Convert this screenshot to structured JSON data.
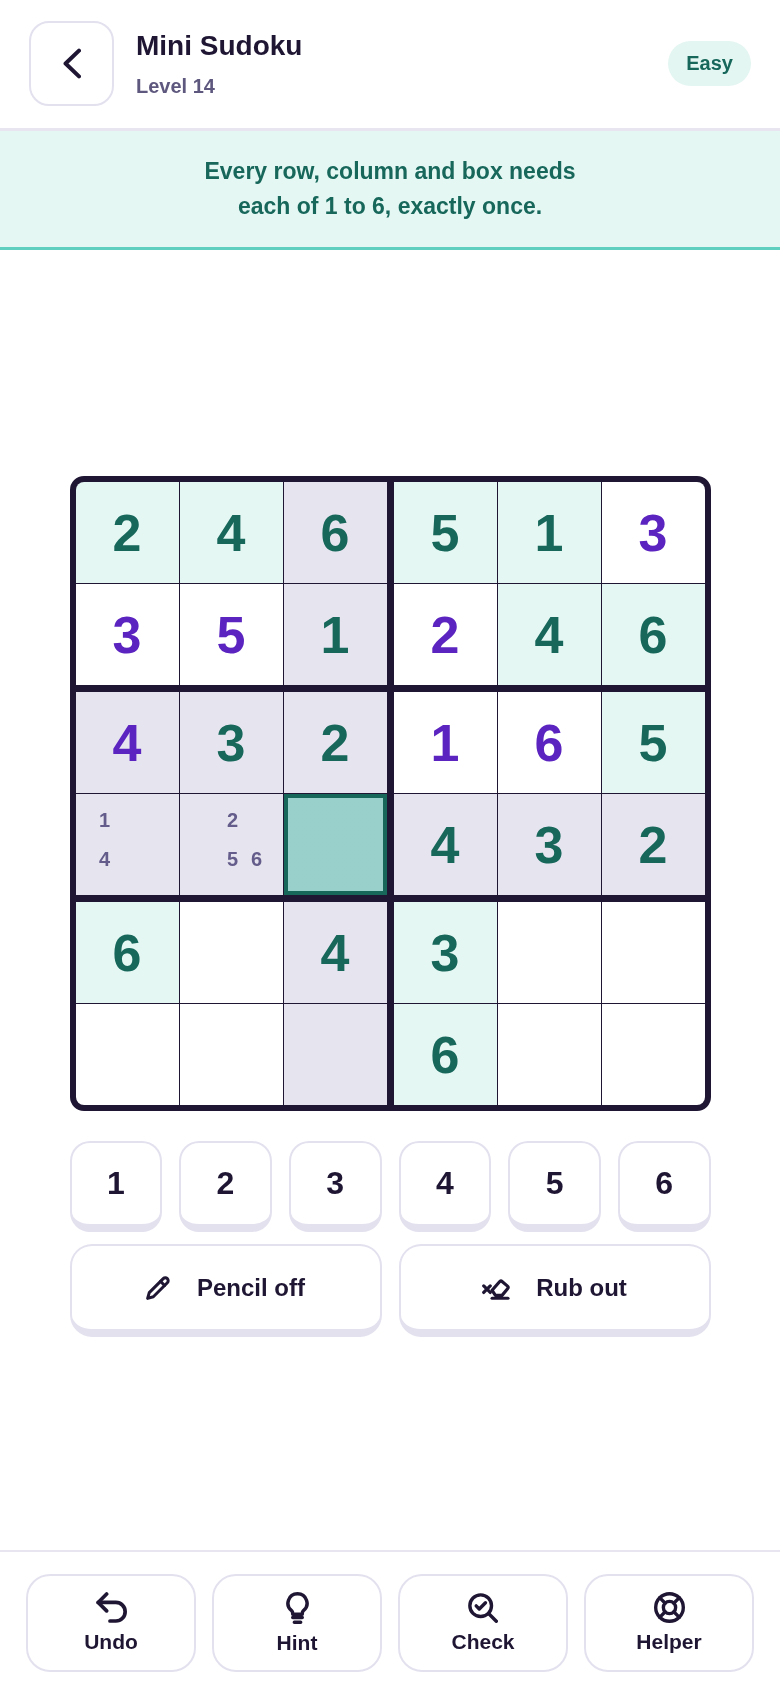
{
  "header": {
    "title": "Mini Sudoku",
    "subtitle": "Level 14",
    "difficulty": "Easy"
  },
  "instructions": "Every row, column and box needs each of 1 to 6, exactly once.",
  "grid": {
    "rows": [
      [
        {
          "kind": "digit",
          "value": "2",
          "given": true,
          "highlighted": false,
          "selected": false
        },
        {
          "kind": "digit",
          "value": "4",
          "given": true,
          "highlighted": false,
          "selected": false
        },
        {
          "kind": "digit",
          "value": "6",
          "given": true,
          "highlighted": true,
          "selected": false
        },
        {
          "kind": "digit",
          "value": "5",
          "given": true,
          "highlighted": false,
          "selected": false
        },
        {
          "kind": "digit",
          "value": "1",
          "given": true,
          "highlighted": false,
          "selected": false
        },
        {
          "kind": "digit",
          "value": "3",
          "given": false,
          "highlighted": false,
          "selected": false
        }
      ],
      [
        {
          "kind": "digit",
          "value": "3",
          "given": false,
          "highlighted": false,
          "selected": false
        },
        {
          "kind": "digit",
          "value": "5",
          "given": false,
          "highlighted": false,
          "selected": false
        },
        {
          "kind": "digit",
          "value": "1",
          "given": true,
          "highlighted": true,
          "selected": false
        },
        {
          "kind": "digit",
          "value": "2",
          "given": false,
          "highlighted": false,
          "selected": false
        },
        {
          "kind": "digit",
          "value": "4",
          "given": true,
          "highlighted": false,
          "selected": false
        },
        {
          "kind": "digit",
          "value": "6",
          "given": true,
          "highlighted": false,
          "selected": false
        }
      ],
      [
        {
          "kind": "digit",
          "value": "4",
          "given": false,
          "highlighted": true,
          "selected": false
        },
        {
          "kind": "digit",
          "value": "3",
          "given": true,
          "highlighted": true,
          "selected": false
        },
        {
          "kind": "digit",
          "value": "2",
          "given": true,
          "highlighted": true,
          "selected": false
        },
        {
          "kind": "digit",
          "value": "1",
          "given": false,
          "highlighted": false,
          "selected": false
        },
        {
          "kind": "digit",
          "value": "6",
          "given": false,
          "highlighted": false,
          "selected": false
        },
        {
          "kind": "digit",
          "value": "5",
          "given": true,
          "highlighted": false,
          "selected": false
        }
      ],
      [
        {
          "kind": "notes",
          "notes": [
            "1",
            "4"
          ],
          "given": false,
          "highlighted": true,
          "selected": false
        },
        {
          "kind": "notes",
          "notes": [
            "2",
            "5",
            "6"
          ],
          "given": false,
          "highlighted": true,
          "selected": false
        },
        {
          "kind": "empty",
          "given": false,
          "highlighted": true,
          "selected": true
        },
        {
          "kind": "digit",
          "value": "4",
          "given": true,
          "highlighted": true,
          "selected": false
        },
        {
          "kind": "digit",
          "value": "3",
          "given": true,
          "highlighted": true,
          "selected": false
        },
        {
          "kind": "digit",
          "value": "2",
          "given": true,
          "highlighted": true,
          "selected": false
        }
      ],
      [
        {
          "kind": "digit",
          "value": "6",
          "given": true,
          "highlighted": false,
          "selected": false
        },
        {
          "kind": "empty",
          "given": false,
          "highlighted": false,
          "selected": false
        },
        {
          "kind": "digit",
          "value": "4",
          "given": true,
          "highlighted": true,
          "selected": false
        },
        {
          "kind": "digit",
          "value": "3",
          "given": true,
          "highlighted": false,
          "selected": false
        },
        {
          "kind": "empty",
          "given": false,
          "highlighted": false,
          "selected": false
        },
        {
          "kind": "empty",
          "given": false,
          "highlighted": false,
          "selected": false
        }
      ],
      [
        {
          "kind": "empty",
          "given": false,
          "highlighted": false,
          "selected": false
        },
        {
          "kind": "empty",
          "given": false,
          "highlighted": false,
          "selected": false
        },
        {
          "kind": "empty",
          "given": false,
          "highlighted": true,
          "selected": false
        },
        {
          "kind": "digit",
          "value": "6",
          "given": true,
          "highlighted": false,
          "selected": false
        },
        {
          "kind": "empty",
          "given": false,
          "highlighted": false,
          "selected": false
        },
        {
          "kind": "empty",
          "given": false,
          "highlighted": false,
          "selected": false
        }
      ]
    ]
  },
  "number_pad": [
    "1",
    "2",
    "3",
    "4",
    "5",
    "6"
  ],
  "tools": [
    {
      "kind": "pencil",
      "label": "Pencil off"
    },
    {
      "kind": "eraser",
      "label": "Rub out"
    }
  ],
  "toolbar": [
    {
      "kind": "undo",
      "label": "Undo"
    },
    {
      "kind": "hint",
      "label": "Hint"
    },
    {
      "kind": "check",
      "label": "Check"
    },
    {
      "kind": "helper",
      "label": "Helper"
    }
  ]
}
